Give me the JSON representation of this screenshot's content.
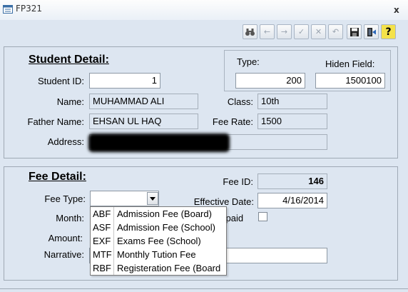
{
  "window": {
    "title": "FP321",
    "close_glyph": "x"
  },
  "toolbar": {
    "buttons": [
      {
        "icon": "binoculars-icon",
        "glyph": "🔍",
        "enabled": true
      },
      {
        "icon": "arrow-left-icon",
        "glyph": "←",
        "enabled": false
      },
      {
        "icon": "arrow-right-icon",
        "glyph": "→",
        "enabled": false
      },
      {
        "icon": "check-icon",
        "glyph": "✓",
        "enabled": false
      },
      {
        "icon": "cancel-x-icon",
        "glyph": "✕",
        "enabled": false
      },
      {
        "icon": "undo-icon",
        "glyph": "↶",
        "enabled": false
      },
      {
        "icon": "save-disk-icon",
        "glyph": "💾",
        "enabled": true
      },
      {
        "icon": "exit-door-icon",
        "glyph": "🚪",
        "enabled": true
      },
      {
        "icon": "help-question-icon",
        "glyph": "?",
        "enabled": true
      }
    ]
  },
  "student": {
    "heading": "Student Detail:",
    "id_label": "Student ID:",
    "id_value": "1",
    "name_label": "Name:",
    "name_value": "MUHAMMAD ALI",
    "father_label": "Father Name:",
    "father_value": "EHSAN UL HAQ",
    "address_label": "Address:",
    "class_label": "Class:",
    "class_value": "10th",
    "feerate_label": "Fee Rate:",
    "feerate_value": "1500",
    "type_label": "Type:",
    "type_value": "200",
    "hidden_label": "Hiden Field:",
    "hidden_value": "1500100"
  },
  "fee": {
    "heading": "Fee Detail:",
    "feetype_label": "Fee Type:",
    "feetype_value": "",
    "month_label": "Month:",
    "amount_label": "Amount:",
    "narrative_label": "Narrative:",
    "narrative_value": "",
    "feeid_label": "Fee ID:",
    "feeid_value": "146",
    "effective_label": "Effective Date:",
    "effective_value": "4/16/2014",
    "unpaid_label": "Unpaid",
    "unpaid_visible": "spaid",
    "unpaid_checked": false
  },
  "dropdown": {
    "options": [
      {
        "code": "ABF",
        "name": "Admission Fee (Board)"
      },
      {
        "code": "ASF",
        "name": "Admission Fee (School)"
      },
      {
        "code": "EXF",
        "name": "Exams Fee (School)"
      },
      {
        "code": "MTF",
        "name": "Monthly Tution Fee"
      },
      {
        "code": "RBF",
        "name": "Registeration Fee (Board"
      }
    ]
  }
}
